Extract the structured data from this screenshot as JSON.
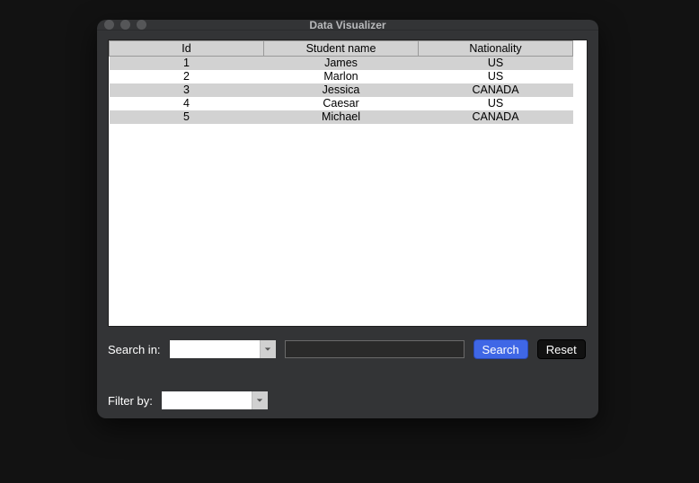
{
  "window": {
    "title": "Data Visualizer"
  },
  "table": {
    "columns": [
      "Id",
      "Student name",
      "Nationality"
    ],
    "rows": [
      {
        "id": "1",
        "name": "James",
        "nat": "US"
      },
      {
        "id": "2",
        "name": "Marlon",
        "nat": "US"
      },
      {
        "id": "3",
        "name": "Jessica",
        "nat": "CANADA"
      },
      {
        "id": "4",
        "name": "Caesar",
        "nat": "US"
      },
      {
        "id": "5",
        "name": "Michael",
        "nat": "CANADA"
      }
    ]
  },
  "search": {
    "label": "Search in:",
    "selected": "",
    "input_value": "",
    "search_btn": "Search",
    "reset_btn": "Reset"
  },
  "filter": {
    "label": "Filter by:",
    "selected": ""
  }
}
